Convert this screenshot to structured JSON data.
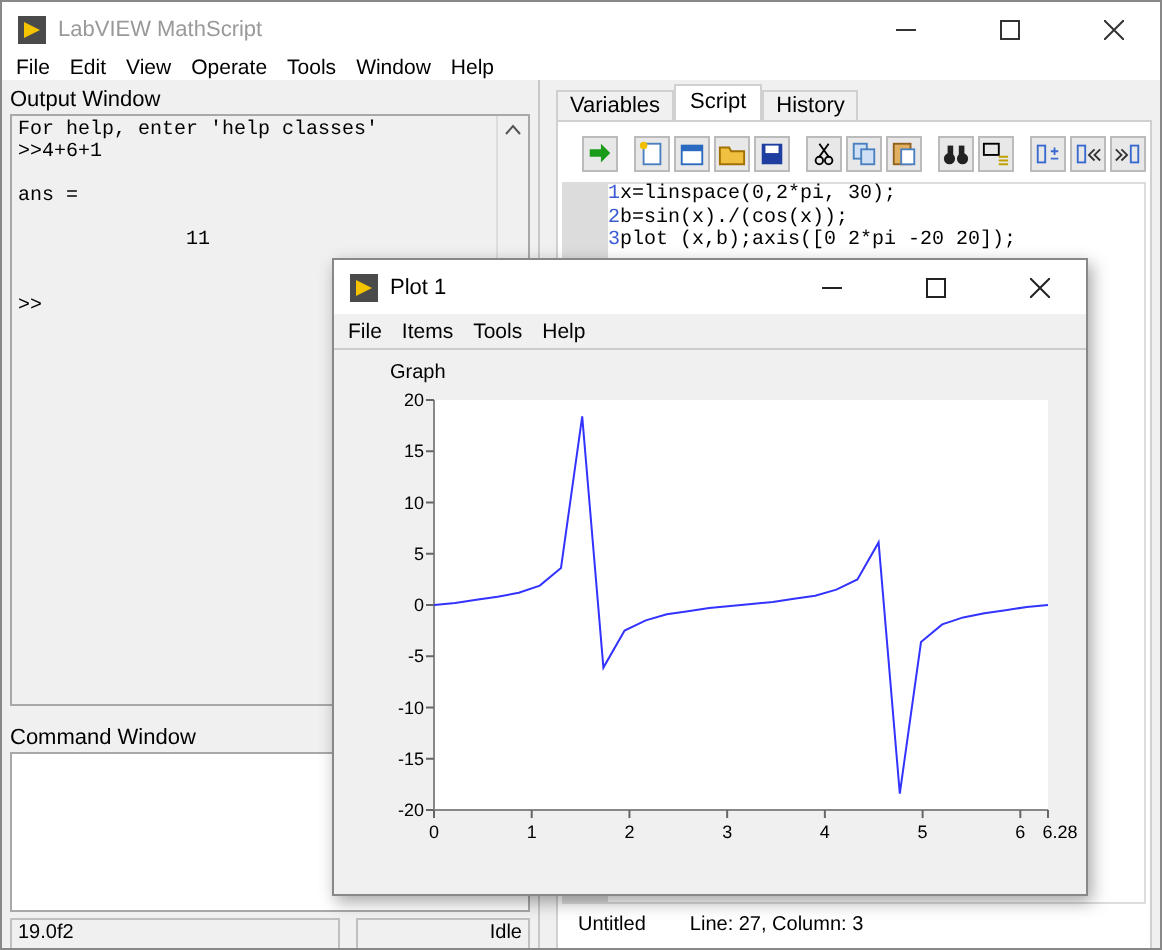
{
  "window": {
    "title": "LabVIEW MathScript"
  },
  "menu": [
    "File",
    "Edit",
    "View",
    "Operate",
    "Tools",
    "Window",
    "Help"
  ],
  "output_window": {
    "label": "Output Window",
    "lines": [
      {
        "text": "For help, enter 'help classes'",
        "kind": "text"
      },
      {
        "text": ">>4+6+1",
        "kind": "text"
      },
      {
        "text": "ans =",
        "kind": "answer"
      },
      {
        "text": "11",
        "kind": "value"
      },
      {
        "text": ">>",
        "kind": "prompt"
      }
    ]
  },
  "command_window": {
    "label": "Command Window"
  },
  "status_left": {
    "version": "19.0f2",
    "state": "Idle"
  },
  "tabs": [
    {
      "label": "Variables",
      "selected": false
    },
    {
      "label": "Script",
      "selected": true
    },
    {
      "label": "History",
      "selected": false
    }
  ],
  "script": {
    "lines": [
      {
        "number": "1",
        "code": "x=linspace(0,2*pi, 30);"
      },
      {
        "number": "2",
        "code": "b=sin(x)./(cos(x));"
      },
      {
        "number": "3",
        "code": "plot (x,b);axis([0 2*pi -20 20]);"
      }
    ]
  },
  "status_right": {
    "file": "Untitled",
    "position": "Line: 27, Column: 3"
  },
  "plot_window": {
    "title": "Plot 1",
    "menu": [
      "File",
      "Items",
      "Tools",
      "Help"
    ],
    "graph": {
      "chart_data": {
        "type": "line",
        "title": "Graph",
        "xlim": [
          0,
          6.2832
        ],
        "ylim": [
          -20,
          20
        ],
        "xticks": [
          0,
          1,
          2,
          3,
          4,
          5,
          6,
          {
            "value": 6.2832,
            "label": "6.28"
          }
        ],
        "yticks": [
          -20,
          -15,
          -10,
          -5,
          0,
          5,
          10,
          15,
          20
        ],
        "x": [
          0,
          0.217,
          0.433,
          0.65,
          0.867,
          1.083,
          1.3,
          1.517,
          1.733,
          1.95,
          2.167,
          2.383,
          2.6,
          2.817,
          3.033,
          3.25,
          3.467,
          3.683,
          3.9,
          4.117,
          4.333,
          4.55,
          4.767,
          4.983,
          5.2,
          5.416,
          5.633,
          5.85,
          6.066,
          6.283
        ],
        "series": [
          {
            "color": "#3333ff",
            "values": [
              0,
              0.2,
              0.5,
              0.8,
              1.2,
              1.9,
              3.6,
              18.4,
              -6.1,
              -2.5,
              -1.5,
              -0.9,
              -0.6,
              -0.3,
              -0.1,
              0.1,
              0.3,
              0.6,
              0.9,
              1.5,
              2.5,
              6.1,
              -18.4,
              -3.6,
              -1.9,
              -1.2,
              -0.8,
              -0.5,
              -0.2,
              0
            ]
          }
        ]
      }
    }
  }
}
